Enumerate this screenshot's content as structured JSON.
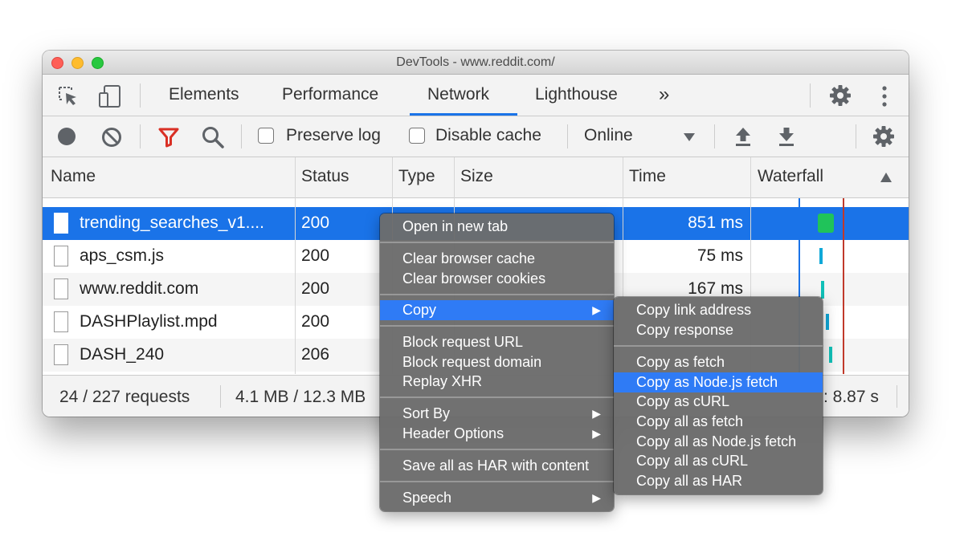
{
  "window": {
    "title": "DevTools - www.reddit.com/"
  },
  "tabs": [
    {
      "label": "Elements"
    },
    {
      "label": "Performance"
    },
    {
      "label": "Network",
      "active": true
    },
    {
      "label": "Lighthouse"
    }
  ],
  "toolbar": {
    "preserve_log": "Preserve log",
    "disable_cache": "Disable cache",
    "throttling": "Online"
  },
  "table": {
    "headers": {
      "name": "Name",
      "status": "Status",
      "type": "Type",
      "size": "Size",
      "time": "Time",
      "waterfall": "Waterfall"
    },
    "rows": [
      {
        "name": "trending_searches_v1....",
        "status": "200",
        "time": "851 ms",
        "selected": true
      },
      {
        "name": "aps_csm.js",
        "status": "200",
        "time": "75 ms"
      },
      {
        "name": "www.reddit.com",
        "status": "200",
        "time": "167 ms"
      },
      {
        "name": "DASHPlaylist.mpd",
        "status": "200",
        "time": ""
      },
      {
        "name": "DASH_240",
        "status": "206",
        "time": ""
      }
    ]
  },
  "status": {
    "requests": "24 / 227 requests",
    "transferred": "4.1 MB / 12.3 MB",
    "finish": ": 8.87 s"
  },
  "context_menu": {
    "open_new_tab": "Open in new tab",
    "clear_cache": "Clear browser cache",
    "clear_cookies": "Clear browser cookies",
    "copy": "Copy",
    "block_url": "Block request URL",
    "block_domain": "Block request domain",
    "replay_xhr": "Replay XHR",
    "sort_by": "Sort By",
    "header_options": "Header Options",
    "save_har": "Save all as HAR with content",
    "speech": "Speech"
  },
  "copy_submenu": {
    "copy_link": "Copy link address",
    "copy_response": "Copy response",
    "copy_fetch": "Copy as fetch",
    "copy_node_fetch": "Copy as Node.js fetch",
    "copy_curl": "Copy as cURL",
    "copy_all_fetch": "Copy all as fetch",
    "copy_all_node_fetch": "Copy all as Node.js fetch",
    "copy_all_curl": "Copy all as cURL",
    "copy_all_har": "Copy all as HAR"
  },
  "colors": {
    "accent": "#1a73e8",
    "menu_highlight": "#2f7bf5",
    "filter_red": "#d93025"
  }
}
